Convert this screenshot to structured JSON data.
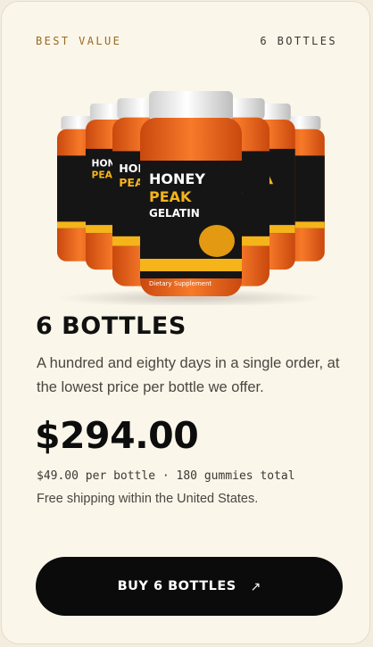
{
  "offer": {
    "badge": "BEST VALUE",
    "count_label": "6 BOTTLES",
    "title": "6 BOTTLES",
    "description": "A hundred and eighty days in a single order, at the lowest price per bottle we offer.",
    "price": "$294.00",
    "per_bottle_meta": "$49.00 per bottle · 180 gummies total",
    "shipping_note": "Free shipping within the United States.",
    "buy_label": "BUY 6 BOTTLES",
    "buy_icon": "↗"
  },
  "product_image": {
    "label_line1": "HONEY",
    "label_line2": "PEAK",
    "label_line3": "GELATIN",
    "supplement_text": "Dietary Supplement",
    "icon": "product-bottles-image"
  },
  "colors": {
    "accent": "#9a6a22",
    "button": "#0b0b0b",
    "card": "#fbf6ea",
    "gummy": "#e8621a",
    "label": "#151515",
    "gold": "#f4b41a"
  }
}
